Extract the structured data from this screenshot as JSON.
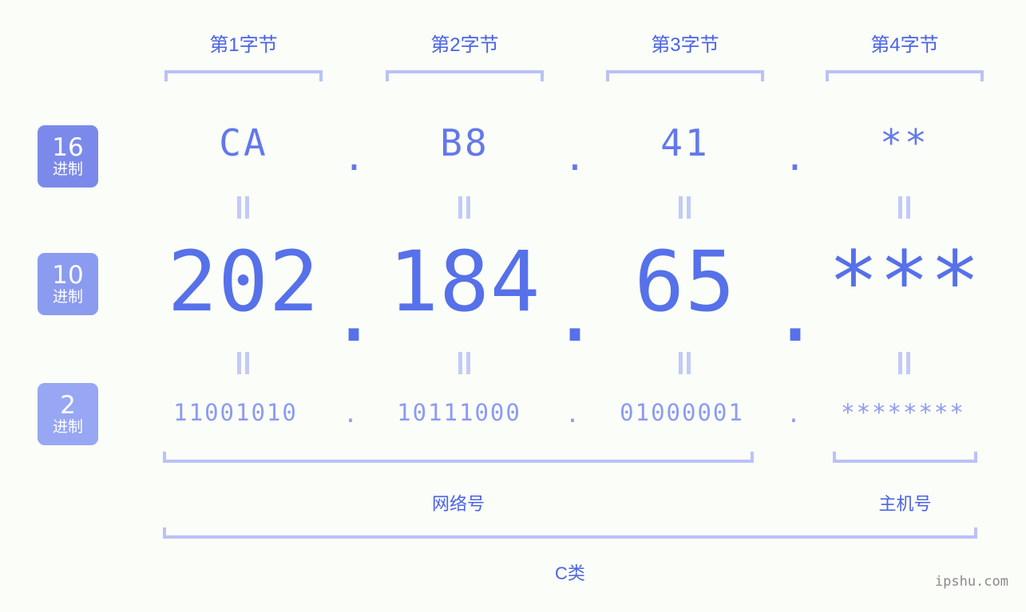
{
  "watermark": "ipshu.com",
  "byte_headers": [
    {
      "label": "第1字节"
    },
    {
      "label": "第2字节"
    },
    {
      "label": "第3字节"
    },
    {
      "label": "第4字节"
    }
  ],
  "bases": [
    {
      "number": "16",
      "unit": "进制"
    },
    {
      "number": "10",
      "unit": "进制"
    },
    {
      "number": "2",
      "unit": "进制"
    }
  ],
  "separator": ".",
  "rows": {
    "hex": {
      "values": [
        "CA",
        "B8",
        "41",
        "**"
      ]
    },
    "decimal": {
      "values": [
        "202",
        "184",
        "65",
        "***"
      ]
    },
    "binary": {
      "values": [
        "11001010",
        "10111000",
        "01000001",
        "********"
      ]
    }
  },
  "regions": {
    "network": "网络号",
    "host": "主机号",
    "class": "C类"
  },
  "colors": {
    "accent": "#4a63e7",
    "value": "#5671e9",
    "muted": "#8b9bf2",
    "bracket": "#b9c2f7",
    "badge_hex": "#7b8aea",
    "badge_dec": "#8b9bef",
    "badge_bin": "#97a7f3",
    "background": "#fbfdf8"
  }
}
